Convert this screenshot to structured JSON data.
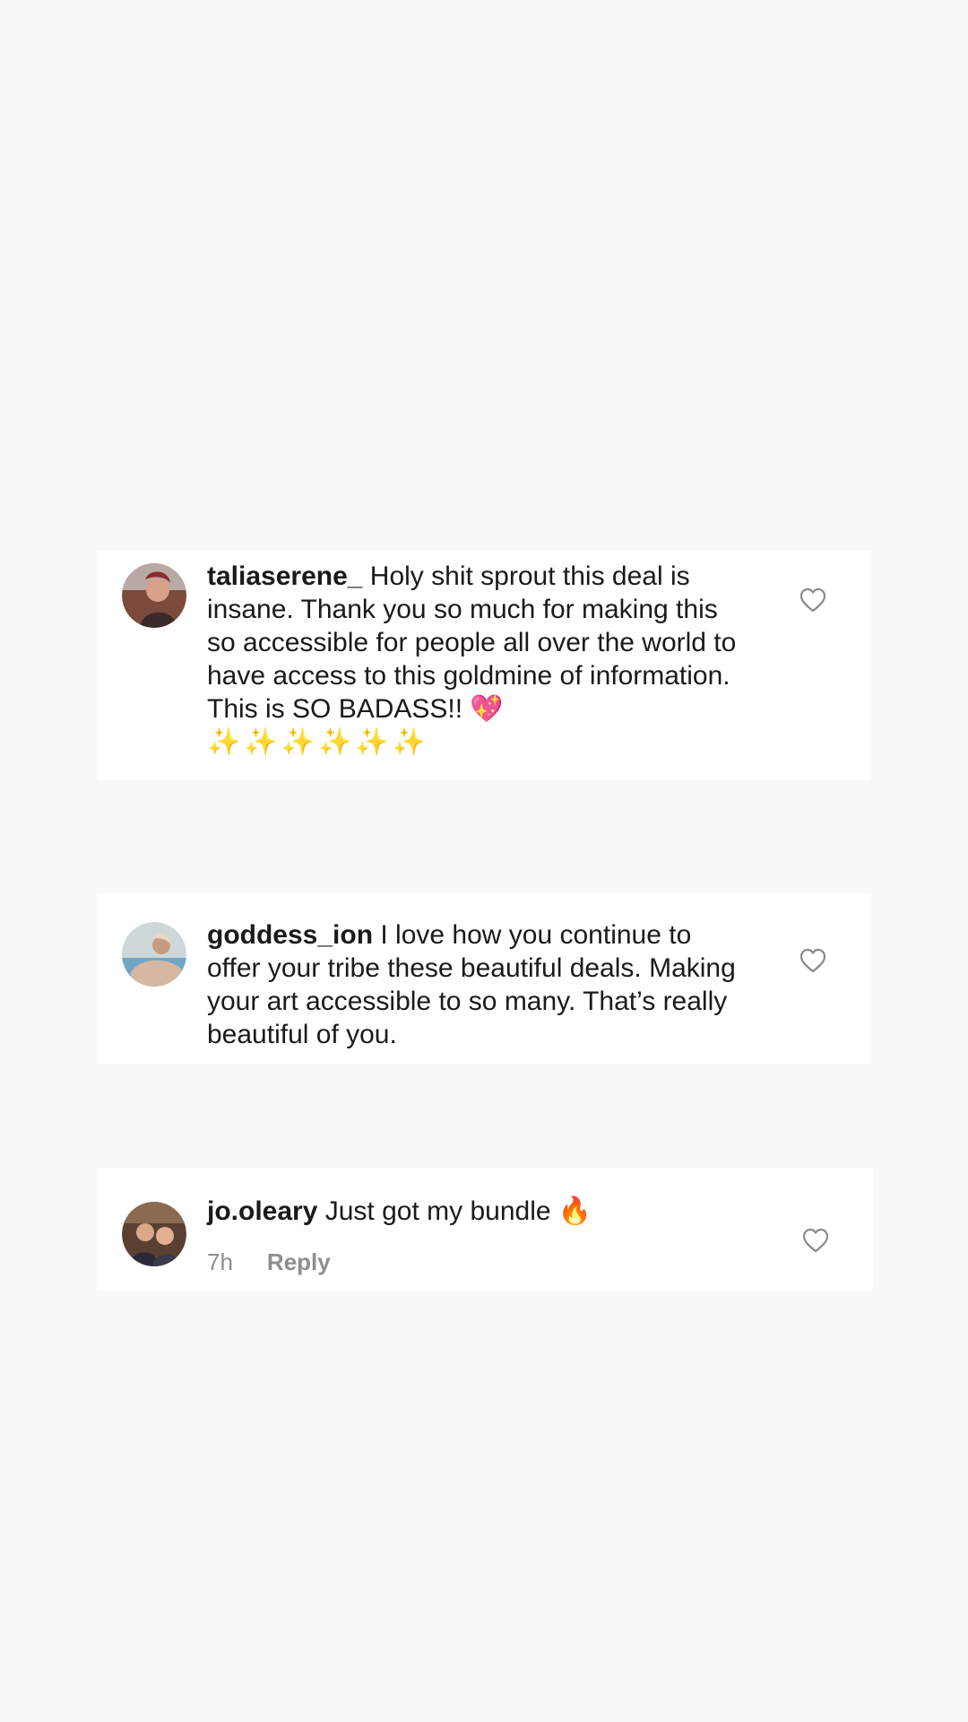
{
  "comments": [
    {
      "username": "taliaserene_",
      "text": "Holy shit sprout this deal is insane. Thank you so much for making this so accessible for people all over the world to have access to this goldmine of information. This is SO BADASS!!",
      "trailing_emoji": "💖",
      "emoji_line": "✨✨✨✨✨✨",
      "avatar_icon": "avatar-portrait"
    },
    {
      "username": "goddess_ion",
      "text": "I love how you continue to offer your tribe these beautiful deals. Making your art accessible to so many. That’s really beautiful of you.",
      "avatar_icon": "avatar-portrait"
    },
    {
      "username": "jo.oleary",
      "text": "Just got my bundle",
      "trailing_emoji": "🔥",
      "time": "7h",
      "reply_label": "Reply",
      "avatar_icon": "avatar-portrait"
    }
  ],
  "colors": {
    "background": "#f8f8f8",
    "card": "#ffffff",
    "text": "#1a1a1a",
    "meta": "#8e8e8e",
    "heart_outline": "#8a8a8a"
  }
}
